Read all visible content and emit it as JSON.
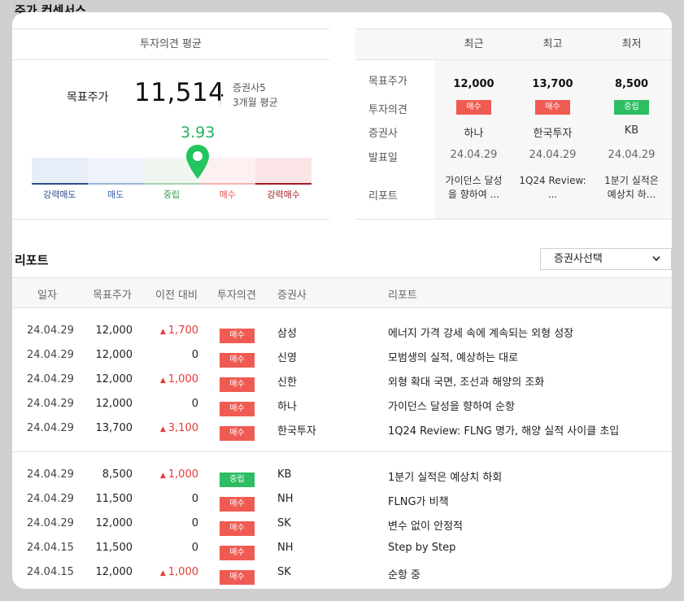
{
  "page_title": "주가 컨센서스",
  "consensus": {
    "header": "투자의견 평균",
    "target_label": "목표주가",
    "target_value": "11,514",
    "broker_count": "증권사5",
    "period": "3개월 평균",
    "score": "3.93",
    "bands": [
      {
        "label": "강력매도",
        "bg": "#e8eef8",
        "line": "#2d4b8a",
        "color": "#2d4b8a"
      },
      {
        "label": "매도",
        "bg": "#eef3fb",
        "line": "#9db3d9",
        "color": "#3a63a8"
      },
      {
        "label": "중립",
        "bg": "#eef6ef",
        "line": "#a3d3ae",
        "color": "#2e9d4c"
      },
      {
        "label": "매수",
        "bg": "#fdf0f0",
        "line": "#f0b3b0",
        "color": "#e0554c"
      },
      {
        "label": "강력매수",
        "bg": "#fbe5e6",
        "line": "#a51c24",
        "color": "#a51c24"
      }
    ],
    "score_color": "#22b35e"
  },
  "summary": {
    "columns": [
      "최근",
      "최고",
      "최저"
    ],
    "row_labels": [
      "목표주가",
      "투자의견",
      "증권사",
      "발표일",
      "리포트"
    ],
    "target_prices": [
      "12,000",
      "13,700",
      "8,500"
    ],
    "opinions": [
      {
        "label": "매수",
        "type": "buy"
      },
      {
        "label": "매수",
        "type": "buy"
      },
      {
        "label": "중립",
        "type": "neutral"
      }
    ],
    "brokers": [
      "하나",
      "한국투자",
      "KB"
    ],
    "dates": [
      "24.04.29",
      "24.04.29",
      "24.04.29"
    ],
    "reports": [
      [
        "가이던스 달성",
        "을 향하여 ..."
      ],
      [
        "1Q24 Review:",
        "..."
      ],
      [
        "1분기 실적은",
        "예상치 하..."
      ]
    ]
  },
  "reports": {
    "title": "리포트",
    "select_label": "증권사선택",
    "headers": {
      "date": "일자",
      "target": "목표주가",
      "change": "이전 대비",
      "opinion": "투자의견",
      "broker": "증권사",
      "report": "리포트"
    },
    "rows": [
      {
        "date": "24.04.29",
        "price": "12,000",
        "change": "1,700",
        "up": true,
        "opinion": "매수",
        "type": "buy",
        "broker": "삼성",
        "title": "에너지 가격 강세 속에 계속되는 외형 성장"
      },
      {
        "date": "24.04.29",
        "price": "12,000",
        "change": "0",
        "up": false,
        "opinion": "매수",
        "type": "buy",
        "broker": "신영",
        "title": "모범생의 실적, 예상하는 대로"
      },
      {
        "date": "24.04.29",
        "price": "12,000",
        "change": "1,000",
        "up": true,
        "opinion": "매수",
        "type": "buy",
        "broker": "신한",
        "title": "외형 확대 국면, 조선과 해양의 조화"
      },
      {
        "date": "24.04.29",
        "price": "12,000",
        "change": "0",
        "up": false,
        "opinion": "매수",
        "type": "buy",
        "broker": "하나",
        "title": "가이던스 달성을 향하여 순항"
      },
      {
        "date": "24.04.29",
        "price": "13,700",
        "change": "3,100",
        "up": true,
        "opinion": "매수",
        "type": "buy",
        "broker": "한국투자",
        "title": "1Q24 Review: FLNG 명가, 해양 실적 사이클 초입"
      },
      {
        "date": "24.04.29",
        "price": "8,500",
        "change": "1,000",
        "up": true,
        "opinion": "중립",
        "type": "neutral",
        "broker": "KB",
        "title": "1분기 실적은 예상치 하회"
      },
      {
        "date": "24.04.29",
        "price": "11,500",
        "change": "0",
        "up": false,
        "opinion": "매수",
        "type": "buy",
        "broker": "NH",
        "title": "FLNG가 비책"
      },
      {
        "date": "24.04.29",
        "price": "12,000",
        "change": "0",
        "up": false,
        "opinion": "매수",
        "type": "buy",
        "broker": "SK",
        "title": "변수 없이 안정적"
      },
      {
        "date": "24.04.15",
        "price": "11,500",
        "change": "0",
        "up": false,
        "opinion": "매수",
        "type": "buy",
        "broker": "NH",
        "title": "Step by Step"
      },
      {
        "date": "24.04.15",
        "price": "12,000",
        "change": "1,000",
        "up": true,
        "opinion": "매수",
        "type": "buy",
        "broker": "SK",
        "title": "순항 중"
      }
    ]
  }
}
